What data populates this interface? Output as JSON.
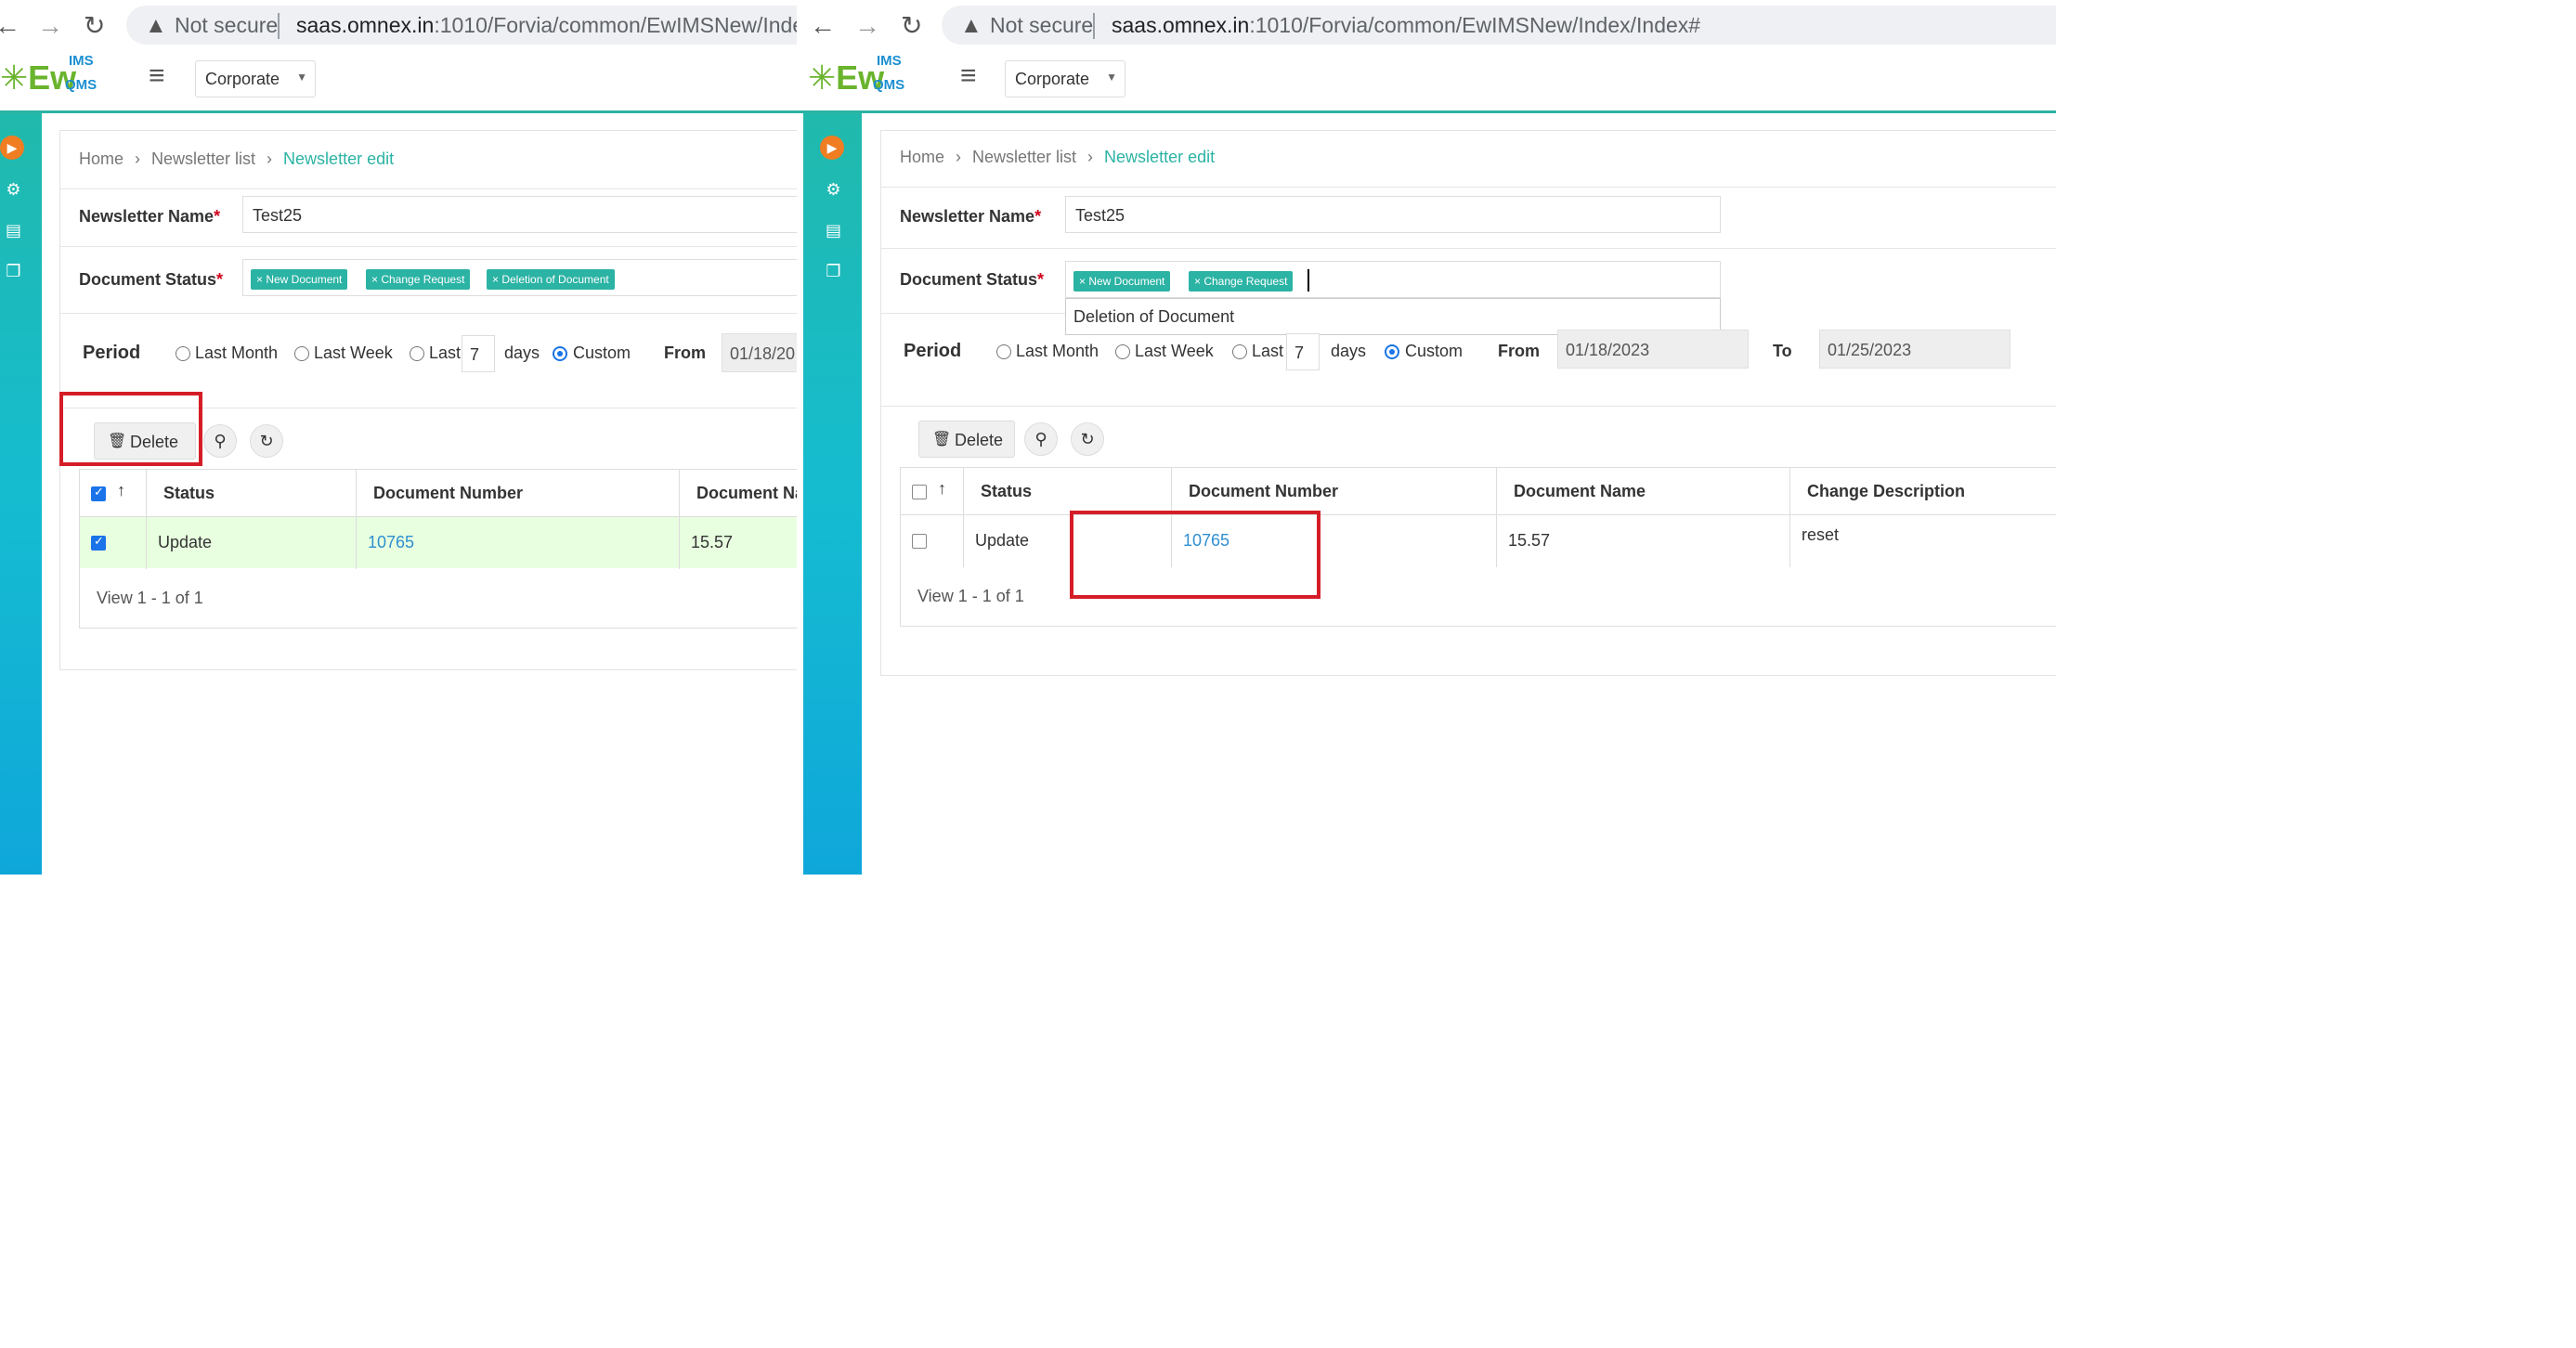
{
  "browser": {
    "not_secure": "Not secure",
    "left_url_host": "saas.omnex.in",
    "left_url_path": ":1010/Forvia/common/EwIMSNew/Index/In",
    "right_url_host": "saas.omnex.in",
    "right_url_path": ":1010/Forvia/common/EwIMSNew/Index/Index#"
  },
  "app": {
    "logo_text": "Ew",
    "logo_ims": "IMS",
    "logo_qms": "QMS",
    "company_select": "Corporate"
  },
  "breadcrumb": {
    "home": "Home",
    "list": "Newsletter list",
    "current": "Newsletter edit"
  },
  "form": {
    "name_label": "Newsletter Name",
    "name_value": "Test25",
    "status_label": "Document Status",
    "required_mark": "*",
    "tags": [
      "× New Document",
      "× Change Request",
      "× Deletion of Document"
    ],
    "dropdown_option": "Deletion of Document"
  },
  "period": {
    "label": "Period",
    "last_month": "Last Month",
    "last_week": "Last Week",
    "last": "Last",
    "days_value": "7",
    "days": "days",
    "custom": "Custom",
    "from_label": "From",
    "from_value_left": "01/18/20",
    "from_value": "01/18/2023",
    "to_label": "To",
    "to_value": "01/25/2023"
  },
  "toolbar": {
    "delete_label": "Delete"
  },
  "grid": {
    "sort_arrow": "↑",
    "columns": [
      "Status",
      "Document Number",
      "Document Name",
      "Change Description"
    ],
    "rows": [
      {
        "status": "Update",
        "doc_number": "10765",
        "doc_name": "15.57",
        "change_desc": "reset"
      }
    ],
    "pager": "View 1 - 1 of 1"
  },
  "colors": {
    "accent": "#2bb3a4",
    "highlight_box": "#d51d27",
    "divider": "#1f2fc4",
    "link": "#2f8fd0"
  }
}
